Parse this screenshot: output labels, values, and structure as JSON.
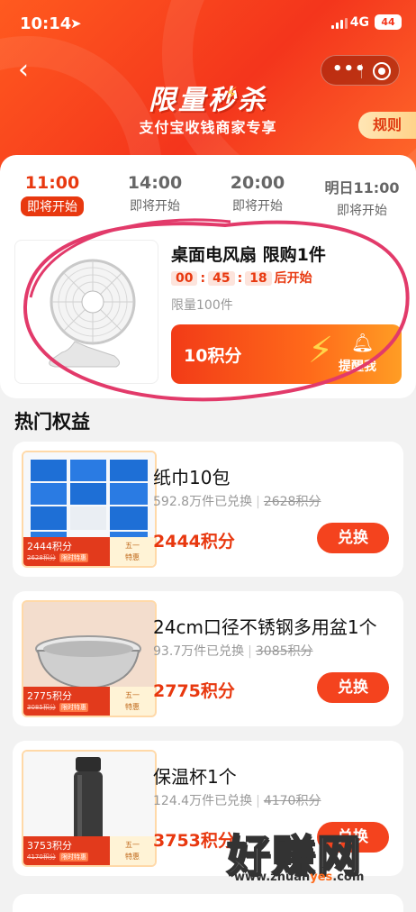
{
  "status_bar": {
    "time": "10:14",
    "network": "4G",
    "battery": "44"
  },
  "header": {
    "title": "限量秒杀",
    "subtitle": "支付宝收钱商家专享",
    "rules_label": "规则"
  },
  "time_slots": [
    {
      "time": "11:00",
      "status": "即将开始",
      "active": true
    },
    {
      "time": "14:00",
      "status": "即将开始",
      "active": false
    },
    {
      "time": "20:00",
      "status": "即将开始",
      "active": false
    },
    {
      "time": "明日11:00",
      "status": "即将开始",
      "active": false
    }
  ],
  "seckill_item": {
    "name": "桌面电风扇 限购1件",
    "countdown": {
      "h": "00",
      "m": "45",
      "s": "18",
      "suffix": "后开始"
    },
    "limit": "限量100件",
    "points": "10积分",
    "remind_label": "提醒我"
  },
  "section_title": "热门权益",
  "items": [
    {
      "name": "纸巾10包",
      "sold": "592.8万件已兑换",
      "original": "2628积分",
      "price": "2444积分",
      "badge_price": "2444积分",
      "badge_original": "2628积分",
      "badge_hot": "限时特惠",
      "tag": "五一\n特惠",
      "button": "兑换"
    },
    {
      "name": "24cm口径不锈钢多用盆1个",
      "sold": "93.7万件已兑换",
      "original": "3085积分",
      "price": "2775积分",
      "badge_price": "2775积分",
      "badge_original": "3085积分",
      "badge_hot": "限时特惠",
      "tag": "五一\n特惠",
      "button": "兑换"
    },
    {
      "name": "保温杯1个",
      "sold": "124.4万件已兑换",
      "original": "4170积分",
      "price": "3753积分",
      "badge_price": "3753积分",
      "badge_original": "4170积分",
      "badge_hot": "限时特惠",
      "tag": "五一\n特惠",
      "button": "兑换"
    }
  ],
  "watermark": {
    "text": "好赚网",
    "url_prefix": "www.zhuan",
    "url_highlight": "yes",
    "url_suffix": ".com"
  },
  "colors": {
    "brand_red": "#e8380f",
    "hero_orange": "#ff5a1f",
    "annotation_pink": "#e23a6a"
  }
}
